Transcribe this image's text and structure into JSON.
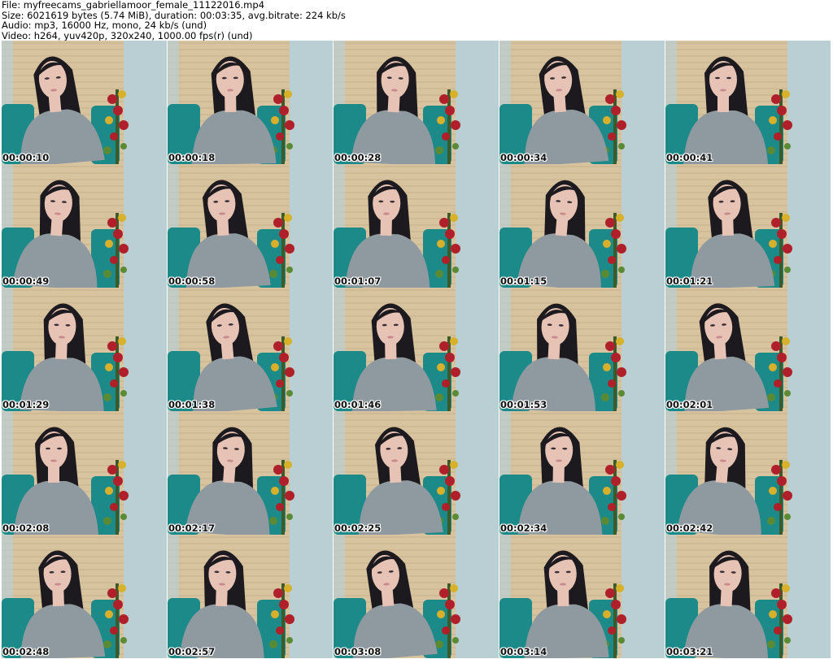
{
  "header": {
    "file": "File: myfreecams_gabriellamoor_female_11122016.mp4",
    "size": "Size: 6021619 bytes (5.74 MiB), duration: 00:03:35, avg.bitrate: 224 kb/s",
    "audio": "Audio: mp3, 16000 Hz, mono, 24 kb/s (und)",
    "video": "Video: h264, yuv420p, 320x240, 1000.00 fps(r) (und)"
  },
  "thumbnails": [
    {
      "timestamp": "00:00:10"
    },
    {
      "timestamp": "00:00:18"
    },
    {
      "timestamp": "00:00:28"
    },
    {
      "timestamp": "00:00:34"
    },
    {
      "timestamp": "00:00:41"
    },
    {
      "timestamp": "00:00:49"
    },
    {
      "timestamp": "00:00:58"
    },
    {
      "timestamp": "00:01:07"
    },
    {
      "timestamp": "00:01:15"
    },
    {
      "timestamp": "00:01:21"
    },
    {
      "timestamp": "00:01:29"
    },
    {
      "timestamp": "00:01:38"
    },
    {
      "timestamp": "00:01:46"
    },
    {
      "timestamp": "00:01:53"
    },
    {
      "timestamp": "00:02:01"
    },
    {
      "timestamp": "00:02:08"
    },
    {
      "timestamp": "00:02:17"
    },
    {
      "timestamp": "00:02:25"
    },
    {
      "timestamp": "00:02:34"
    },
    {
      "timestamp": "00:02:42"
    },
    {
      "timestamp": "00:02:48"
    },
    {
      "timestamp": "00:02:57"
    },
    {
      "timestamp": "00:03:08"
    },
    {
      "timestamp": "00:03:14"
    },
    {
      "timestamp": "00:03:21"
    }
  ],
  "colors": {
    "background": "#ffffff",
    "wall": "#b9cfd4",
    "shutter": "#d8c39f",
    "chair": "#1d8a8a",
    "shirt": "#8f9aa0",
    "hair": "#1c1a1e",
    "skin": "#e6c3b4",
    "flowers": "#b0202a"
  }
}
